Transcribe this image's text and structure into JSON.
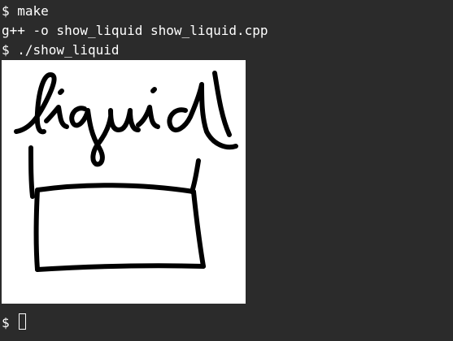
{
  "terminal": {
    "lines": [
      "$ make",
      "g++ -o show_liquid show_liquid.cpp",
      "$ ./show_liquid"
    ],
    "prompt": "$"
  },
  "drawing": {
    "word": "liquid",
    "background_color": "#ffffff",
    "ink_color": "#000000"
  }
}
